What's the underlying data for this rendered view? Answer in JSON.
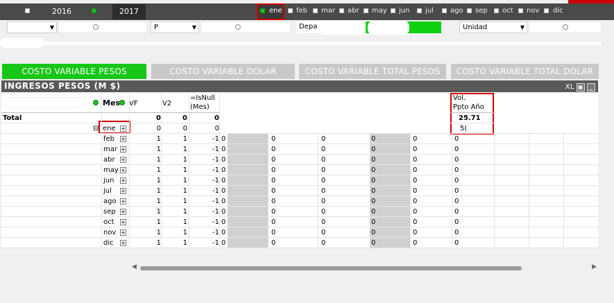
{
  "years": [
    "2016",
    "2017"
  ],
  "months": [
    "ene",
    "feb",
    "mar",
    "abr",
    "may",
    "jun",
    "jul",
    "ago",
    "sep",
    "oct",
    "nov",
    "dic"
  ],
  "selectors": {
    "second_value": "P",
    "third_value": "Depa",
    "unidad": "Unidad"
  },
  "tabs": [
    "COSTO VARIABLE PESOS",
    "COSTO VARIABLE DOLAR",
    "COSTO VARIABLE TOTAL PESOS",
    "COSTO VARIABLE TOTAL DOLAR"
  ],
  "panel": {
    "title": "INGRESOS PESOS (M $)",
    "xl": "XL"
  },
  "table": {
    "col_mes": "Mes",
    "col_vf": "VF",
    "col_v2": "V2",
    "col_isnull_1": "=IsNull",
    "col_isnull_2": "(Mes)",
    "col_vol_1": "Vol.",
    "col_vol_2": "Ppto Año",
    "total_label": "Total",
    "total_vf": "0",
    "total_v2": "0",
    "total_isnull": "0",
    "vol_value": "25.71",
    "vol_partial": "5(",
    "ene_row": {
      "vf": "0",
      "v2": "0",
      "isnull": "0"
    },
    "rows_vf": "1",
    "rows_v2": "1",
    "rows_isnull": "-1",
    "rows_zero": "0"
  },
  "colors": {
    "accent_green": "#16c616",
    "highlight_red": "#d40000",
    "title_bar": "#595959"
  }
}
